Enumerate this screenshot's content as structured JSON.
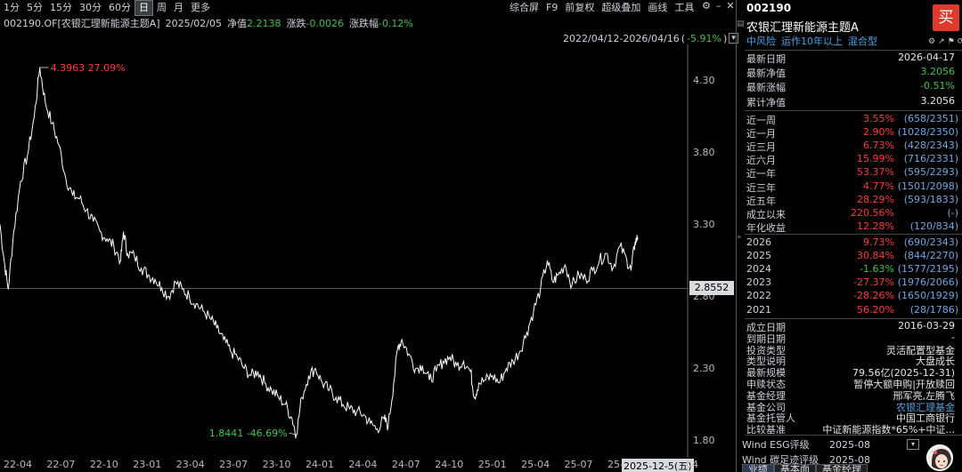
{
  "toolbar": {
    "periods": [
      "1分",
      "5分",
      "15分",
      "30分",
      "60分",
      "日",
      "周",
      "月",
      "更多"
    ],
    "active_period": "日",
    "right_items": [
      "综合屏",
      "F9",
      "前复权",
      "超级叠加",
      "画线",
      "工具"
    ],
    "window_icons": [
      "settings-icon",
      "minimize-icon",
      "close-icon"
    ]
  },
  "infobar": {
    "code_name": "002190.OF[农银汇理新能源主题A]",
    "date": "2025/02/05",
    "nav_label": "净值",
    "nav_value": "2.2138",
    "chg_label": "涨跌",
    "chg_value": "-0.0026",
    "pct_label": "涨跌幅",
    "pct_value": "-0.12%"
  },
  "rangebar": {
    "range": "2022/04/12-2026/04/16",
    "pct": "-5.91%",
    "sep": "(",
    "end": ")"
  },
  "chart_data": {
    "type": "line",
    "x_ticks": [
      "22-04",
      "22-07",
      "22-10",
      "23-01",
      "23-04",
      "23-07",
      "23-10",
      "24-01",
      "24-04",
      "24-07",
      "24-10",
      "25-01",
      "25-04",
      "25-07",
      "25-10"
    ],
    "y_ticks": [
      "4.30",
      "3.80",
      "3.30",
      "2.80",
      "2.30",
      "1.80"
    ],
    "ylim": [
      1.68,
      4.55
    ],
    "high_label": "4.3963 27.09%",
    "low_label": "1.8441 -46.69%",
    "current_value_tag": "2.8552",
    "cursor_date": "2025-12-5(五)",
    "series_color": "#ffffff",
    "points": [
      [
        0,
        3.3
      ],
      [
        0.3,
        3.05
      ],
      [
        0.6,
        2.85
      ],
      [
        1.0,
        3.25
      ],
      [
        1.5,
        3.6
      ],
      [
        2.0,
        3.78
      ],
      [
        2.5,
        4.05
      ],
      [
        2.9,
        4.39
      ],
      [
        3.3,
        4.15
      ],
      [
        3.8,
        4.0
      ],
      [
        4.3,
        3.85
      ],
      [
        4.8,
        3.62
      ],
      [
        5.3,
        3.5
      ],
      [
        5.8,
        3.48
      ],
      [
        6.3,
        3.4
      ],
      [
        6.8,
        3.32
      ],
      [
        7.3,
        3.25
      ],
      [
        7.8,
        3.2
      ],
      [
        8.3,
        3.15
      ],
      [
        8.8,
        3.05
      ],
      [
        9.0,
        3.25
      ],
      [
        9.3,
        3.1
      ],
      [
        9.8,
        3.08
      ],
      [
        10.3,
        3.0
      ],
      [
        10.8,
        2.95
      ],
      [
        11.3,
        2.92
      ],
      [
        11.8,
        2.86
      ],
      [
        12.3,
        2.8
      ],
      [
        12.8,
        2.9
      ],
      [
        13.3,
        2.85
      ],
      [
        13.8,
        2.8
      ],
      [
        14.3,
        2.75
      ],
      [
        14.8,
        2.7
      ],
      [
        15.3,
        2.65
      ],
      [
        15.8,
        2.58
      ],
      [
        16.3,
        2.5
      ],
      [
        16.8,
        2.42
      ],
      [
        17.3,
        2.38
      ],
      [
        17.8,
        2.3
      ],
      [
        18.3,
        2.25
      ],
      [
        18.8,
        2.28
      ],
      [
        19.3,
        2.2
      ],
      [
        19.8,
        2.15
      ],
      [
        20.3,
        2.1
      ],
      [
        20.8,
        2.05
      ],
      [
        21.3,
        1.95
      ],
      [
        21.6,
        1.84
      ],
      [
        22.0,
        2.1
      ],
      [
        22.5,
        2.25
      ],
      [
        23.0,
        2.3
      ],
      [
        23.5,
        2.2
      ],
      [
        24.0,
        2.15
      ],
      [
        24.5,
        2.1
      ],
      [
        25.0,
        2.05
      ],
      [
        25.5,
        2.02
      ],
      [
        26.0,
        2.0
      ],
      [
        26.5,
        1.98
      ],
      [
        27.0,
        1.92
      ],
      [
        27.5,
        1.88
      ],
      [
        28.0,
        1.95
      ],
      [
        28.3,
        1.9
      ],
      [
        28.7,
        2.2
      ],
      [
        29.0,
        2.45
      ],
      [
        29.3,
        2.5
      ],
      [
        29.8,
        2.4
      ],
      [
        30.3,
        2.3
      ],
      [
        30.8,
        2.32
      ],
      [
        31.3,
        2.22
      ],
      [
        31.8,
        2.28
      ],
      [
        32.3,
        2.35
      ],
      [
        32.8,
        2.38
      ],
      [
        33.3,
        2.32
      ],
      [
        33.8,
        2.35
      ],
      [
        34.3,
        2.28
      ],
      [
        34.6,
        2.1
      ],
      [
        34.9,
        2.2
      ],
      [
        35.4,
        2.22
      ],
      [
        35.9,
        2.25
      ],
      [
        36.4,
        2.2
      ],
      [
        36.9,
        2.3
      ],
      [
        37.4,
        2.35
      ],
      [
        37.9,
        2.42
      ],
      [
        38.4,
        2.55
      ],
      [
        38.9,
        2.7
      ],
      [
        39.4,
        2.85
      ],
      [
        39.9,
        3.05
      ],
      [
        40.3,
        2.9
      ],
      [
        40.7,
        2.95
      ],
      [
        41.2,
        3.02
      ],
      [
        41.7,
        2.88
      ],
      [
        42.2,
        2.95
      ],
      [
        42.7,
        2.92
      ],
      [
        43.2,
        2.98
      ],
      [
        43.7,
        3.05
      ],
      [
        44.2,
        3.1
      ],
      [
        44.7,
        3.0
      ],
      [
        45.2,
        3.15
      ],
      [
        45.7,
        3.05
      ],
      [
        46.0,
        2.98
      ],
      [
        46.3,
        3.18
      ],
      [
        46.5,
        3.21
      ]
    ],
    "x_index_max": 50
  },
  "panel": {
    "code": "002190",
    "name": "农银汇理新能源主题A",
    "tags": [
      "中风险",
      "运作10年以上",
      "混合型"
    ],
    "buy_label": "买",
    "mini_icons": [
      "⚙",
      "↗",
      "⚑",
      "⟳",
      "⌂"
    ],
    "latest": [
      {
        "k": "最新日期",
        "v": "2026-04-17",
        "cls": ""
      },
      {
        "k": "最新净值",
        "v": "3.2056",
        "cls": "green"
      },
      {
        "k": "最新涨幅",
        "v": "-0.51%",
        "cls": "green"
      },
      {
        "k": "累计净值",
        "v": "3.2056",
        "cls": ""
      }
    ],
    "returns": [
      {
        "k": "近一周",
        "v1": "3.55%",
        "v2": "(658/2351)",
        "c": "red"
      },
      {
        "k": "近一月",
        "v1": "2.90%",
        "v2": "(1028/2350)",
        "c": "red"
      },
      {
        "k": "近三月",
        "v1": "6.73%",
        "v2": "(428/2343)",
        "c": "red"
      },
      {
        "k": "近六月",
        "v1": "15.99%",
        "v2": "(716/2331)",
        "c": "red"
      },
      {
        "k": "近一年",
        "v1": "53.37%",
        "v2": "(595/2293)",
        "c": "red"
      },
      {
        "k": "近三年",
        "v1": "4.77%",
        "v2": "(1501/2098)",
        "c": "red"
      },
      {
        "k": "近五年",
        "v1": "28.29%",
        "v2": "(593/1833)",
        "c": "red"
      },
      {
        "k": "成立以来",
        "v1": "220.56%",
        "v2": "(-)",
        "c": "red"
      },
      {
        "k": "年化收益",
        "v1": "12.28%",
        "v2": "(120/834)",
        "c": "red"
      }
    ],
    "years": [
      {
        "k": "2026",
        "v1": "9.73%",
        "v2": "(690/2343)",
        "c": "red"
      },
      {
        "k": "2025",
        "v1": "30.84%",
        "v2": "(844/2270)",
        "c": "red"
      },
      {
        "k": "2024",
        "v1": "-1.63%",
        "v2": "(1577/2195)",
        "c": "green"
      },
      {
        "k": "2023",
        "v1": "-27.37%",
        "v2": "(1976/2066)",
        "c": "red"
      },
      {
        "k": "2022",
        "v1": "-28.26%",
        "v2": "(1650/1929)",
        "c": "red"
      },
      {
        "k": "2021",
        "v1": "56.20%",
        "v2": "(28/1786)",
        "c": "red"
      }
    ],
    "info": [
      {
        "k": "成立日期",
        "v": "2016-03-29",
        "c": ""
      },
      {
        "k": "到期日期",
        "v": "-",
        "c": ""
      },
      {
        "k": "投资类型",
        "v": "灵活配置型基金",
        "c": ""
      },
      {
        "k": "类型说明",
        "v": "大盘成长",
        "c": ""
      },
      {
        "k": "最新规模",
        "v": "79.56亿(2025-12-31)",
        "c": ""
      },
      {
        "k": "申赎状态",
        "v": "暂停大额申购|开放赎回",
        "c": ""
      },
      {
        "k": "基金经理",
        "v": "邢军亮,左腾飞",
        "c": ""
      },
      {
        "k": "基金公司",
        "v": "农银汇理基金",
        "c": "blue"
      },
      {
        "k": "基金托管人",
        "v": "中国工商银行",
        "c": ""
      },
      {
        "k": "比较基准",
        "v": "中证新能源指数*65%+中证...",
        "c": ""
      }
    ],
    "esg": [
      {
        "k": "Wind ESG评级",
        "v": "2025-08"
      },
      {
        "k": "Wind 碳足迹评级",
        "v": "2025-08"
      }
    ],
    "bottom_tabs": [
      "业绩",
      "基本面",
      "基金经理"
    ]
  }
}
